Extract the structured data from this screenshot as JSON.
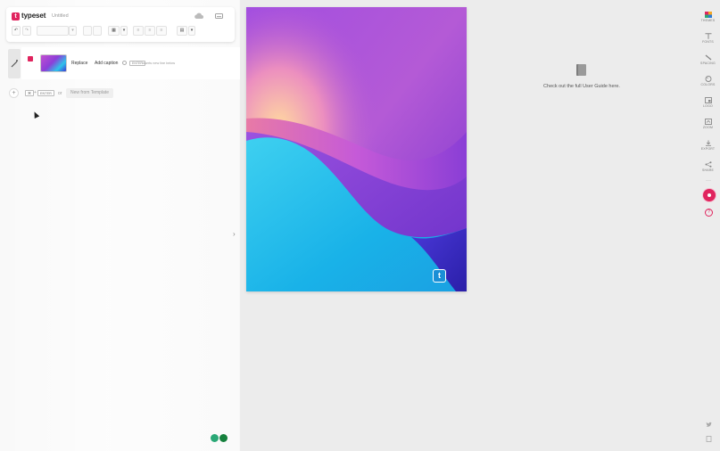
{
  "app": {
    "logo_letter": "t",
    "name": "typeset",
    "document_title": "Untitled"
  },
  "toolbar": {
    "undo": "↶",
    "redo": "↷",
    "table_icon": "▦",
    "caret": "▾",
    "align_icons": [
      "≡",
      "≡",
      "≡"
    ],
    "calendar_icon": "▤"
  },
  "block": {
    "replace_label": "Replace",
    "add_caption_label": "Add caption",
    "hint_key": "ENTER",
    "hint_text": "inserts new line below"
  },
  "add_row": {
    "key1": "⌘",
    "plus": "+",
    "key2": "ENTER",
    "or": "or",
    "template_label": "New from Template"
  },
  "guide": {
    "text": "Check out the full User Guide here."
  },
  "canvas": {
    "logo_letter": "t"
  },
  "rail": {
    "items": [
      {
        "label": "THEMES",
        "icon": "themes-icon"
      },
      {
        "label": "FONTS",
        "icon": "fonts-icon"
      },
      {
        "label": "SPACING",
        "icon": "spacing-icon"
      },
      {
        "label": "COLORS",
        "icon": "colors-icon"
      },
      {
        "label": "LOGO",
        "icon": "logo-icon"
      },
      {
        "label": "ZOOM",
        "icon": "zoom-icon"
      },
      {
        "label": "EXPORT",
        "icon": "export-icon"
      },
      {
        "label": "SHARE",
        "icon": "share-icon"
      }
    ],
    "more": "···",
    "help": "?"
  },
  "colors": {
    "accent": "#e0245e",
    "panel": "#f9f9f9",
    "workspace": "#ececec"
  }
}
